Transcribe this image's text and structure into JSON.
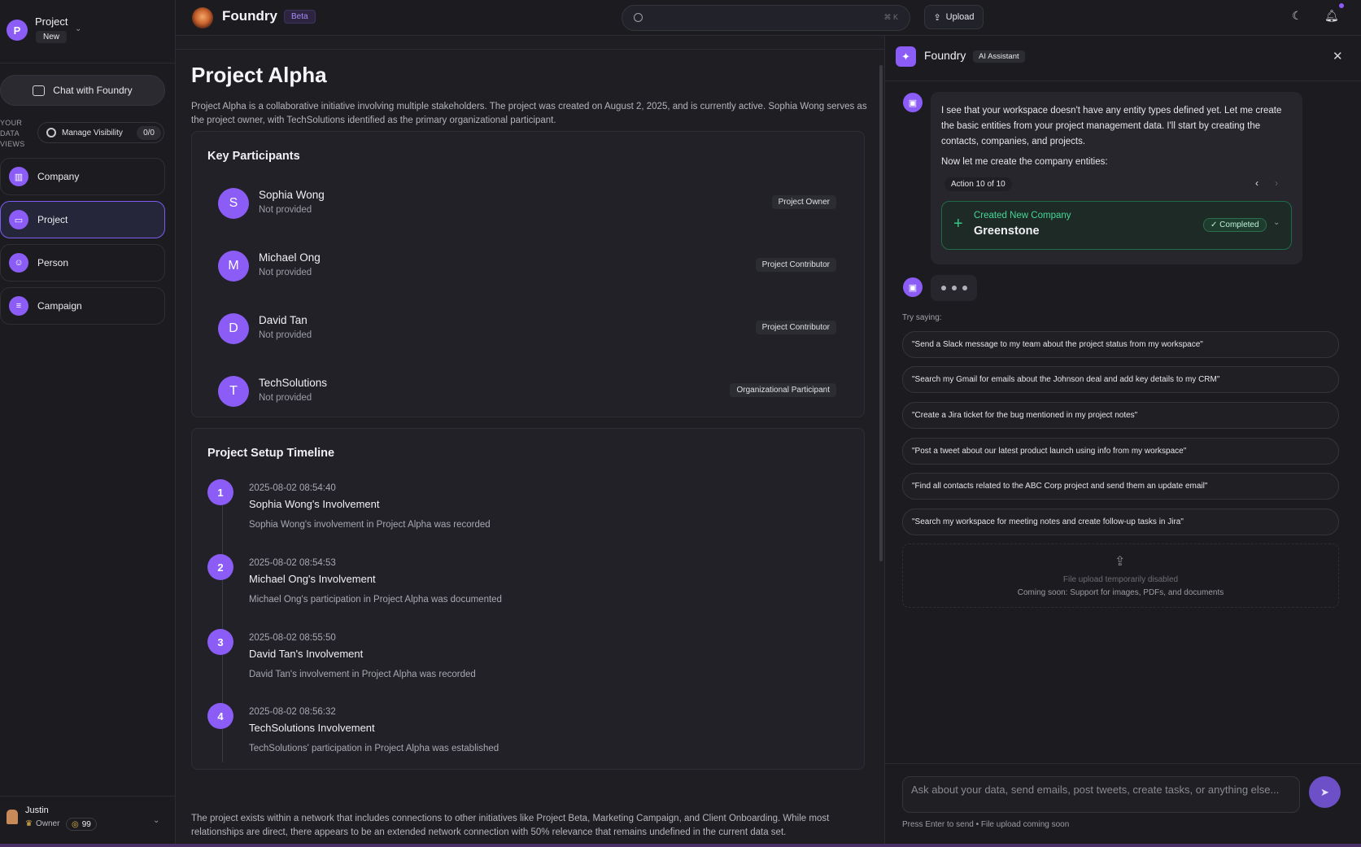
{
  "workspace": {
    "avatar_letter": "P",
    "name": "Project",
    "badge": "New"
  },
  "sidebar": {
    "chat_button": "Chat with Foundry",
    "data_views_label": "YOUR DATA VIEWS",
    "manage_visibility": {
      "label": "Manage Visibility",
      "count": "0/0"
    },
    "items": [
      {
        "label": "Company",
        "icon": "building-icon",
        "active": false
      },
      {
        "label": "Project",
        "icon": "folder-icon",
        "active": true
      },
      {
        "label": "Person",
        "icon": "people-icon",
        "active": false
      },
      {
        "label": "Campaign",
        "icon": "document-icon",
        "active": false
      }
    ]
  },
  "user": {
    "name": "Justin",
    "role": "Owner",
    "credits": "99"
  },
  "topbar": {
    "brand": "Foundry",
    "badge": "Beta",
    "search_placeholder": "",
    "search_shortcut": "⌘ K",
    "upload_label": "Upload"
  },
  "main": {
    "title": "Project Alpha",
    "description": "Project Alpha is a collaborative initiative involving multiple stakeholders. The project was created on August 2, 2025, and is currently active. Sophia Wong serves as the project owner, with TechSolutions identified as the primary organizational participant.",
    "participants_title": "Key Participants",
    "participants": [
      {
        "initial": "S",
        "name": "Sophia Wong",
        "detail": "Not provided",
        "role": "Project Owner"
      },
      {
        "initial": "M",
        "name": "Michael Ong",
        "detail": "Not provided",
        "role": "Project Contributor"
      },
      {
        "initial": "D",
        "name": "David Tan",
        "detail": "Not provided",
        "role": "Project Contributor"
      },
      {
        "initial": "T",
        "name": "TechSolutions",
        "detail": "Not provided",
        "role": "Organizational Participant"
      }
    ],
    "timeline_title": "Project Setup Timeline",
    "timeline": [
      {
        "num": "1",
        "time": "2025-08-02 08:54:40",
        "title": "Sophia Wong's Involvement",
        "desc": "Sophia Wong's involvement in Project Alpha was recorded"
      },
      {
        "num": "2",
        "time": "2025-08-02 08:54:53",
        "title": "Michael Ong's Involvement",
        "desc": "Michael Ong's participation in Project Alpha was documented"
      },
      {
        "num": "3",
        "time": "2025-08-02 08:55:50",
        "title": "David Tan's Involvement",
        "desc": "David Tan's involvement in Project Alpha was recorded"
      },
      {
        "num": "4",
        "time": "2025-08-02 08:56:32",
        "title": "TechSolutions Involvement",
        "desc": "TechSolutions' participation in Project Alpha was established"
      }
    ],
    "footer": "The project exists within a network that includes connections to other initiatives like Project Beta, Marketing Campaign, and Client Onboarding. While most relationships are direct, there appears to be an extended network connection with 50% relevance that remains undefined in the current data set."
  },
  "assistant": {
    "title": "Foundry",
    "badge": "AI Assistant",
    "message": "I see that your workspace doesn't have any entity types defined yet. Let me create the basic entities from your project management data. I'll start by creating the contacts, companies, and projects.",
    "message2": "Now let me create the company entities:",
    "action_counter": "Action 10 of 10",
    "action": {
      "kind": "Created New Company",
      "entity": "Greenstone",
      "status": "Completed"
    },
    "try_label": "Try saying:",
    "suggestions": [
      "\"Send a Slack message to my team about the project status from my workspace\"",
      "\"Search my Gmail for emails about the Johnson deal and add key details to my CRM\"",
      "\"Create a Jira ticket for the bug mentioned in my project notes\"",
      "\"Post a tweet about our latest product launch using info from my workspace\"",
      "\"Find all contacts related to the ABC Corp project and send them an update email\"",
      "\"Search my workspace for meeting notes and create follow-up tasks in Jira\""
    ],
    "upload_disabled": "File upload temporarily disabled",
    "upload_soon": "Coming soon: Support for images, PDFs, and documents",
    "composer_placeholder": "Ask about your data, send emails, post tweets, create tasks, or anything else...",
    "composer_hint": "Press Enter to send • File upload coming soon"
  },
  "colors": {
    "accent": "#8b5cf6",
    "success": "#34c784",
    "background": "#1c1c20"
  }
}
